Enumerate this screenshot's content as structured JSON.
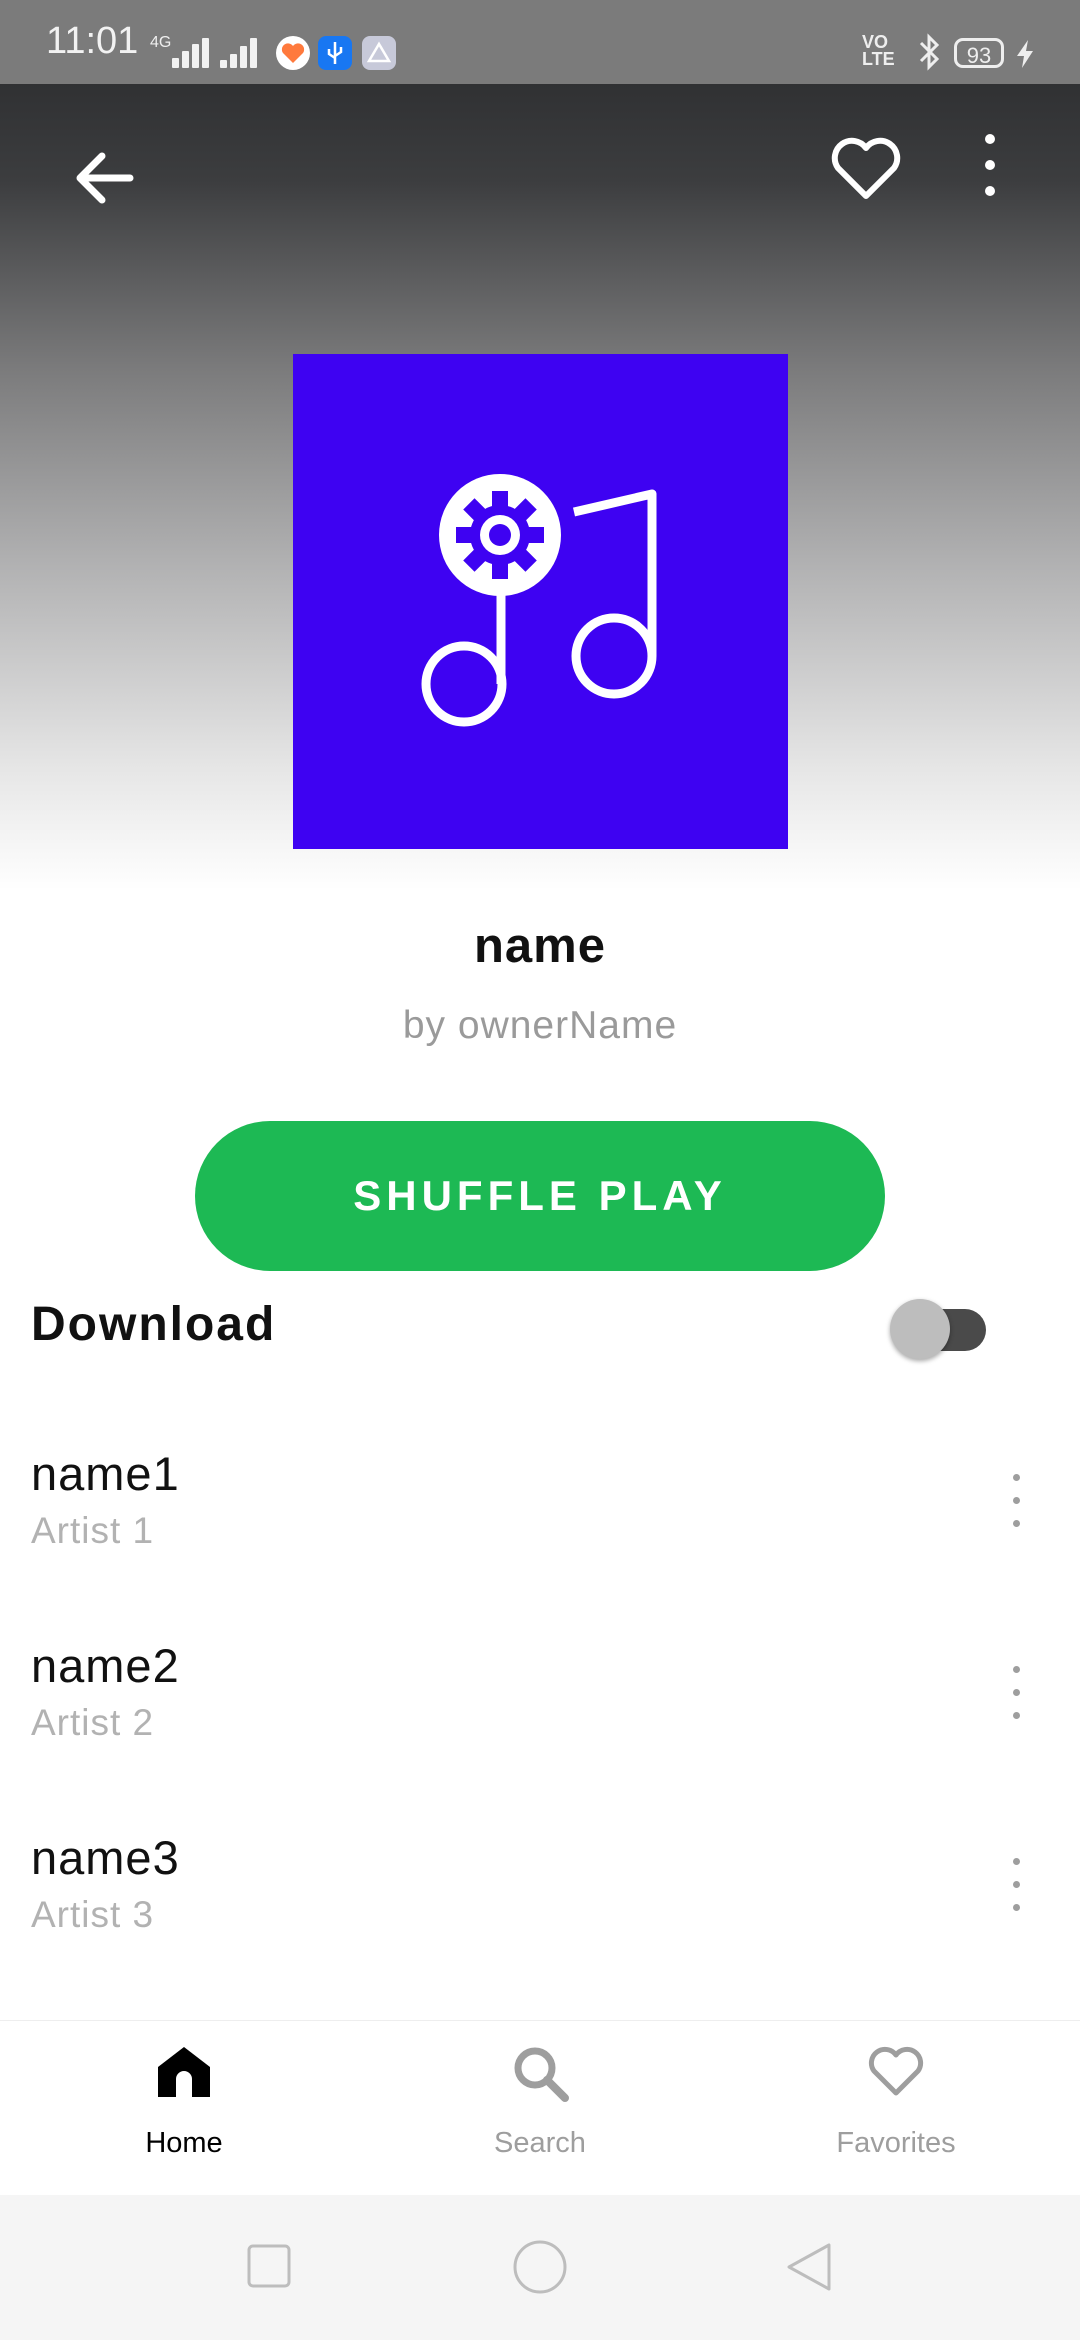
{
  "status_bar": {
    "time": "11:01",
    "network": "4G",
    "volte": "VO LTE",
    "battery": "93"
  },
  "header": {
    "back_icon": "arrow-left-icon",
    "favorite_icon": "heart-outline-icon",
    "menu_icon": "more-vert-icon"
  },
  "playlist": {
    "cover_icon": "music-note-gear-icon",
    "cover_color": "#3e02f2",
    "title": "name",
    "owner": "by ownerName"
  },
  "actions": {
    "shuffle_label": "SHUFFLE PLAY",
    "shuffle_color": "#1db954",
    "download_label": "Download",
    "download_enabled": false
  },
  "tracks": [
    {
      "name": "name1",
      "artist": "Artist 1"
    },
    {
      "name": "name2",
      "artist": "Artist 2"
    },
    {
      "name": "name3",
      "artist": "Artist 3"
    }
  ],
  "bottom_nav": {
    "items": [
      {
        "label": "Home",
        "icon": "home-icon",
        "active": true
      },
      {
        "label": "Search",
        "icon": "search-icon",
        "active": false
      },
      {
        "label": "Favorites",
        "icon": "heart-outline-icon",
        "active": false
      }
    ],
    "active_color": "#000000",
    "inactive_color": "#9e9e9e"
  },
  "system_nav": {
    "items": [
      "recent-apps-icon",
      "home-circle-icon",
      "back-triangle-icon"
    ]
  }
}
